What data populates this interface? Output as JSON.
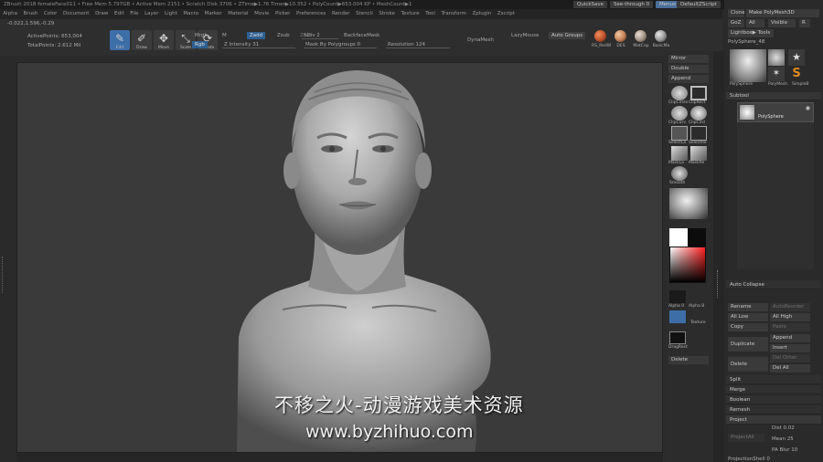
{
  "titlebar": {
    "text": "ZBrush 2018   femaleFace011   • Free Mem 5.797GB • Active Mem 2151 • Scratch Disk 3706 • ZTime▶1.76 Timer▶10.352 • PolyCount▶653.004 KP • MeshCount▶1",
    "quicksave": "QuickSave",
    "seethrough": "See-through  0",
    "menus": "Menus",
    "script": "DefaultZScript"
  },
  "menubar": [
    "Alpha",
    "Brush",
    "Color",
    "Document",
    "Draw",
    "Edit",
    "File",
    "Layer",
    "Light",
    "Macro",
    "Marker",
    "Material",
    "Movie",
    "Picker",
    "Preferences",
    "Render",
    "Stencil",
    "Stroke",
    "Texture",
    "Tool",
    "Transform",
    "Zplugin",
    "Zscript"
  ],
  "coord": "-0.022,1.596,-0.29",
  "shelf": {
    "active_points": "ActivePoints: 653,004",
    "total_points": "TotalPoints: 2.612 Mil",
    "tools": [
      {
        "label": "Edit",
        "icon": "✎",
        "active": true
      },
      {
        "label": "Draw",
        "icon": "✐",
        "active": false
      },
      {
        "label": "Move",
        "icon": "✥",
        "active": false
      },
      {
        "label": "Scale",
        "icon": "⤡",
        "active": false
      },
      {
        "label": "Rotate",
        "icon": "⟳",
        "active": false
      }
    ],
    "mrgb": "Mrgb",
    "rgb": "Rgb",
    "m": "M",
    "zadd": "Zadd",
    "zsub": "Zsub",
    "zcut": "Zcut",
    "z_intensity": "Z Intensity 31",
    "sdiv": "SDiv 2",
    "backface_mask": "BackfaceMask",
    "mask_by_polygroups": "Mask By Polygroups 0",
    "resolution": "Resolution 124",
    "dynamesh": "DynaMesh",
    "lazymouse": "LazyMouse",
    "auto_groups": "Auto Groups",
    "materials": [
      {
        "label": "RS_RedW",
        "color": "#c2572e"
      },
      {
        "label": "DES",
        "color": "#c9865a"
      },
      {
        "label": "MatCap",
        "color": "#a99a8a"
      },
      {
        "label": "BasicMa",
        "color": "#9d9d9d"
      }
    ]
  },
  "right_shelf": {
    "mirror": "Mirror",
    "double": "Double",
    "append": "Append",
    "icons": [
      [
        "ClipCircle",
        "ClipRect"
      ],
      [
        "ClipCurv",
        "ClipCircl"
      ],
      [
        "SelectLa",
        "SelectRe"
      ],
      [
        "MaskLa",
        "MaskRe"
      ],
      [
        "Smooth",
        ""
      ]
    ],
    "delete": "Delete",
    "alpha": "Alpha 0",
    "alpha2": "Alpha 8",
    "texture": "Texture",
    "dragrect": "DragRect"
  },
  "tool_panel": {
    "top_row": [
      "Clone",
      "Make PolyMesh3D"
    ],
    "goz": "GoZ",
    "all": "All",
    "visible": "Visible",
    "r": "R",
    "lightbox_tools": "Lightbox▶ Tools",
    "polysphere": "PolySphere_48",
    "thumbs": [
      "PolySphere",
      "PolyMesh",
      "SimpleB"
    ],
    "subtool": "Subtool",
    "subtool_item": "PolySphere",
    "auto_collapse": "Auto Collapse",
    "buttons": {
      "rename": "Rename",
      "autoreorder": "AutoReorder",
      "all_low": "All Low",
      "all_high": "All High",
      "copy": "Copy",
      "paste": "Paste",
      "duplicate": "Duplicate",
      "append": "Append",
      "insert": "Insert",
      "delete": "Delete",
      "del_other": "Del Other",
      "del_all": "Del All"
    },
    "sections": [
      "Split",
      "Merge",
      "Boolean",
      "Remesh",
      "Project"
    ],
    "project": {
      "dist": "Dist 0.02",
      "mean": "Mean 25",
      "pa_blur": "PA Blur 10",
      "project_all": "ProjectAll",
      "projection_shell": "ProjectionShell 0"
    }
  },
  "watermark": {
    "title": "不移之火-动漫游戏美术资源",
    "url": "www.byzhihuo.com"
  }
}
